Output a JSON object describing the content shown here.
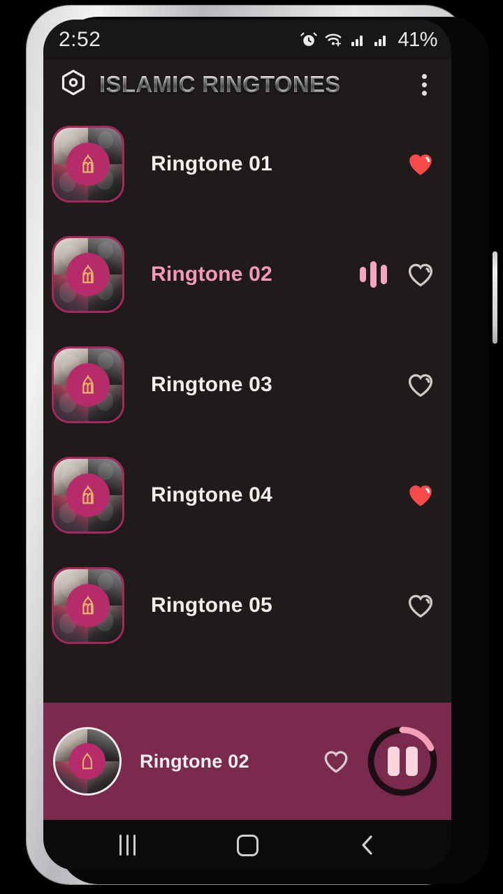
{
  "status_bar": {
    "time": "2:52",
    "battery_percent": "41%",
    "icons": [
      "alarm-icon",
      "wifi-icon",
      "signal-sim1-icon",
      "signal-sim2-icon"
    ]
  },
  "header": {
    "title": "ISLAMIC RINGTONES",
    "logo_icon": "hexagon-logo-icon",
    "overflow_icon": "overflow-menu-icon"
  },
  "colors": {
    "screen_bg": "#1e1b1a",
    "accent_pink": "#f599b8",
    "player_bar_bg": "#7a2a4c",
    "heart_filled": "#f84a4a",
    "heart_outline": "#cfc9c7",
    "thumb_border": "#a8275f",
    "mosque_circle": "#b62c6a",
    "mosque_glyph": "#e8b46a"
  },
  "list": {
    "items": [
      {
        "title": "Ringtone 01",
        "favorite": true,
        "playing": false
      },
      {
        "title": "Ringtone 02",
        "favorite": false,
        "playing": true
      },
      {
        "title": "Ringtone 03",
        "favorite": false,
        "playing": false
      },
      {
        "title": "Ringtone 04",
        "favorite": true,
        "playing": false
      },
      {
        "title": "Ringtone 05",
        "favorite": false,
        "playing": false
      }
    ]
  },
  "player": {
    "title": "Ringtone 02",
    "favorite": false,
    "state": "playing",
    "button_icon": "pause-icon",
    "progress_percent": 18
  },
  "nav_bar": {
    "recents_label": "recents-icon",
    "home_label": "home-icon",
    "back_label": "back-icon"
  }
}
